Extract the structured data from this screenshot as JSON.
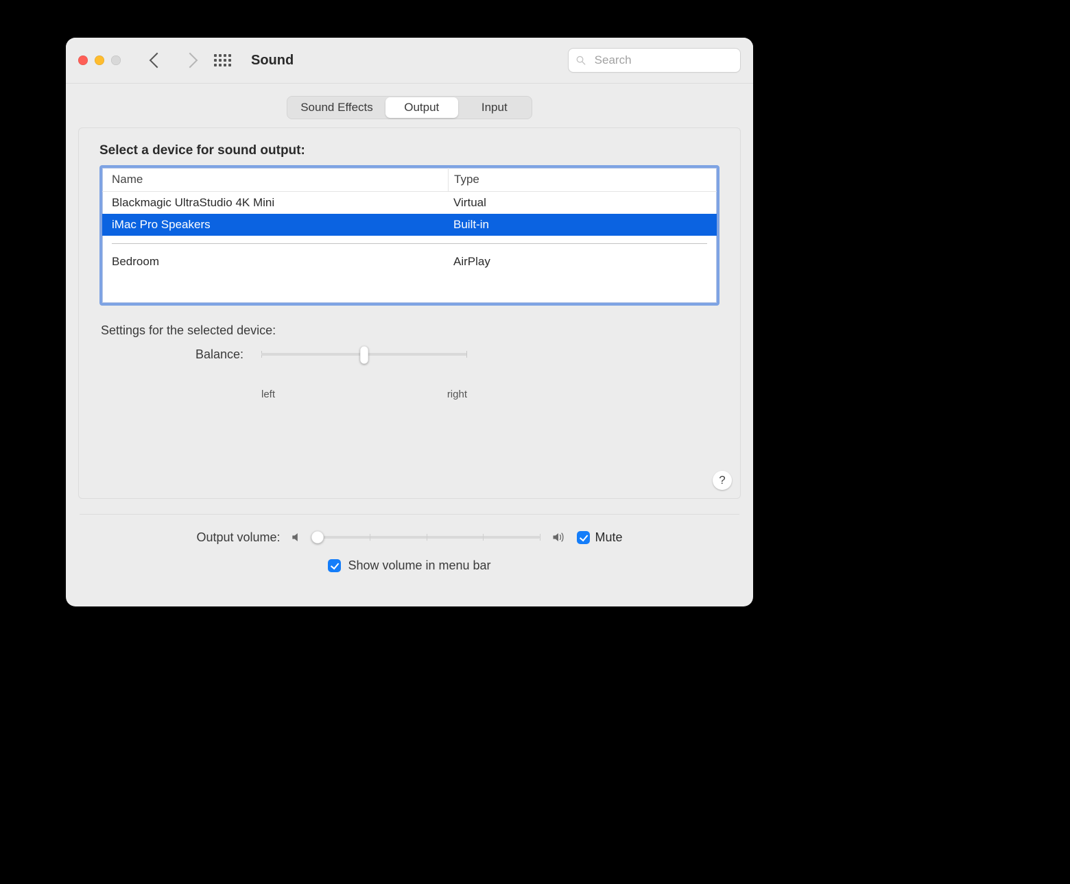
{
  "toolbar": {
    "title": "Sound",
    "search_placeholder": "Search"
  },
  "tabs": {
    "items": [
      {
        "label": "Sound Effects",
        "active": false
      },
      {
        "label": "Output",
        "active": true
      },
      {
        "label": "Input",
        "active": false
      }
    ]
  },
  "section": {
    "select_device_heading": "Select a device for sound output:",
    "columns": {
      "name": "Name",
      "type": "Type"
    },
    "devices": [
      {
        "name": "Blackmagic UltraStudio 4K Mini",
        "type": "Virtual",
        "selected": false
      },
      {
        "name": "iMac Pro Speakers",
        "type": "Built-in",
        "selected": true
      },
      {
        "name": "Bedroom",
        "type": "AirPlay",
        "selected": false,
        "group_break_before": true
      }
    ],
    "settings_heading": "Settings for the selected device:",
    "balance": {
      "label": "Balance:",
      "left_label": "left",
      "right_label": "right",
      "value_percent": 50
    },
    "help_label": "?"
  },
  "footer": {
    "output_volume_label": "Output volume:",
    "output_volume_percent": 2,
    "mute_label": "Mute",
    "mute_checked": true,
    "show_in_menubar_label": "Show volume in menu bar",
    "show_in_menubar_checked": true
  }
}
